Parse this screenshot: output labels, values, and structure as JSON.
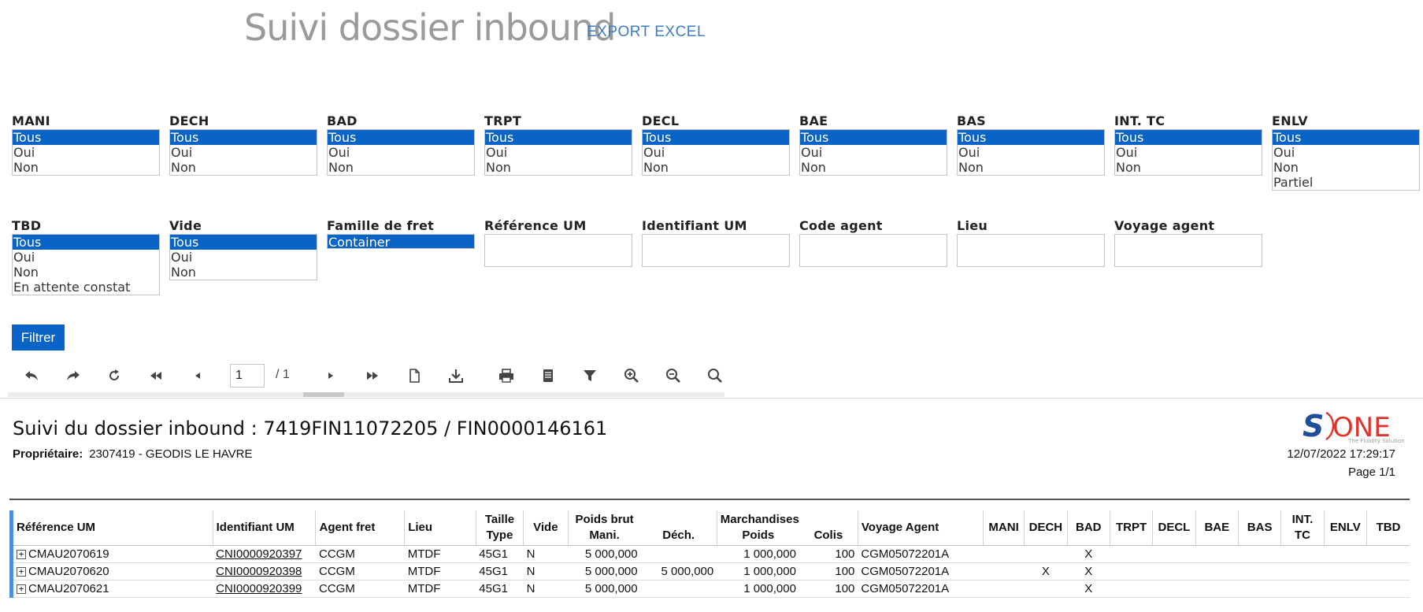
{
  "header": {
    "title": "Suivi dossier inbound",
    "export_label": "EXPORT EXCEL"
  },
  "filters_row1": [
    {
      "label": "MANI",
      "options": [
        "Tous",
        "Oui",
        "Non"
      ]
    },
    {
      "label": "DECH",
      "options": [
        "Tous",
        "Oui",
        "Non"
      ]
    },
    {
      "label": "BAD",
      "options": [
        "Tous",
        "Oui",
        "Non"
      ]
    },
    {
      "label": "TRPT",
      "options": [
        "Tous",
        "Oui",
        "Non"
      ]
    },
    {
      "label": "DECL",
      "options": [
        "Tous",
        "Oui",
        "Non"
      ]
    },
    {
      "label": "BAE",
      "options": [
        "Tous",
        "Oui",
        "Non"
      ]
    },
    {
      "label": "BAS",
      "options": [
        "Tous",
        "Oui",
        "Non"
      ]
    },
    {
      "label": "INT. TC",
      "options": [
        "Tous",
        "Oui",
        "Non"
      ]
    },
    {
      "label": "ENLV",
      "options": [
        "Tous",
        "Oui",
        "Non",
        "Partiel"
      ]
    }
  ],
  "filters_row2": {
    "tbd": {
      "label": "TBD",
      "options": [
        "Tous",
        "Oui",
        "Non",
        "En attente constat"
      ]
    },
    "vide": {
      "label": "Vide",
      "options": [
        "Tous",
        "Oui",
        "Non"
      ]
    },
    "famille": {
      "label": "Famille de fret",
      "options": [
        "Container"
      ]
    },
    "ref_um": {
      "label": "Référence UM",
      "value": ""
    },
    "ident_um": {
      "label": "Identifiant UM",
      "value": ""
    },
    "code_agent": {
      "label": "Code agent",
      "value": ""
    },
    "lieu": {
      "label": "Lieu",
      "value": ""
    },
    "voyage_agent": {
      "label": "Voyage agent",
      "value": ""
    }
  },
  "filter_button": "Filtrer",
  "toolbar": {
    "page_value": "1",
    "page_total": "/ 1",
    "icons": [
      "back-icon",
      "forward-icon",
      "refresh-icon",
      "first-page-icon",
      "prev-page-icon",
      "next-page-icon",
      "last-page-icon",
      "page-setup-icon",
      "download-icon",
      "print-icon",
      "print-page-icon",
      "filter-icon",
      "zoom-in-icon",
      "zoom-out-icon",
      "search-icon"
    ]
  },
  "report": {
    "title": "Suivi du dossier inbound :  7419FIN11072205 / FIN0000146161",
    "owner_label": "Propriétaire:",
    "owner_value": "2307419 - GEODIS LE HAVRE",
    "datetime": "12/07/2022 17:29:17",
    "page_info": "Page 1/1",
    "logo_s": "S",
    "logo_text": "ONE",
    "logo_tagline": "The Fluidity Solution"
  },
  "table": {
    "headers": {
      "ref_um": "Référence UM",
      "ident_um": "Identifiant UM",
      "agent_fret": "Agent fret",
      "lieu": "Lieu",
      "taille": "Taille",
      "type": "Type",
      "vide": "Vide",
      "poids_brut": "Poids brut",
      "mani": "Mani.",
      "dech": "Déch.",
      "marchandises": "Marchandises",
      "poids": "Poids",
      "colis": "Colis",
      "voyage_agent": "Voyage Agent",
      "c_mani": "MANI",
      "c_dech": "DECH",
      "c_bad": "BAD",
      "c_trpt": "TRPT",
      "c_decl": "DECL",
      "c_bae": "BAE",
      "c_bas": "BAS",
      "c_int1": "INT.",
      "c_int2": "TC",
      "c_enlv": "ENLV",
      "c_tbd": "TBD"
    },
    "rows": [
      {
        "ref": "CMAU2070619",
        "ident": "CNI0000920397",
        "agent": "CCGM",
        "lieu": "MTDF",
        "type": "45G1",
        "vide": "N",
        "mani": "5 000,000",
        "dech": "",
        "poids": "1 000,000",
        "colis": "100",
        "voyage": "CGM05072201A",
        "c_mani": "",
        "c_dech": "",
        "c_bad": "X",
        "c_trpt": "",
        "c_decl": "",
        "c_bae": "",
        "c_bas": "",
        "c_int": "",
        "c_enlv": "",
        "c_tbd": ""
      },
      {
        "ref": "CMAU2070620",
        "ident": "CNI0000920398",
        "agent": "CCGM",
        "lieu": "MTDF",
        "type": "45G1",
        "vide": "N",
        "mani": "5 000,000",
        "dech": "5 000,000",
        "poids": "1 000,000",
        "colis": "100",
        "voyage": "CGM05072201A",
        "c_mani": "",
        "c_dech": "X",
        "c_bad": "X",
        "c_trpt": "",
        "c_decl": "",
        "c_bae": "",
        "c_bas": "",
        "c_int": "",
        "c_enlv": "",
        "c_tbd": ""
      },
      {
        "ref": "CMAU2070621",
        "ident": "CNI0000920399",
        "agent": "CCGM",
        "lieu": "MTDF",
        "type": "45G1",
        "vide": "N",
        "mani": "5 000,000",
        "dech": "",
        "poids": "1 000,000",
        "colis": "100",
        "voyage": "CGM05072201A",
        "c_mani": "",
        "c_dech": "",
        "c_bad": "X",
        "c_trpt": "",
        "c_decl": "",
        "c_bae": "",
        "c_bas": "",
        "c_int": "",
        "c_enlv": "",
        "c_tbd": ""
      }
    ]
  },
  "colors": {
    "accent": "#0a64c8",
    "link": "#3c7dc9",
    "row_marker": "#4a8fe0",
    "logo_blue": "#1f4e9a",
    "logo_red": "#e0332b"
  }
}
